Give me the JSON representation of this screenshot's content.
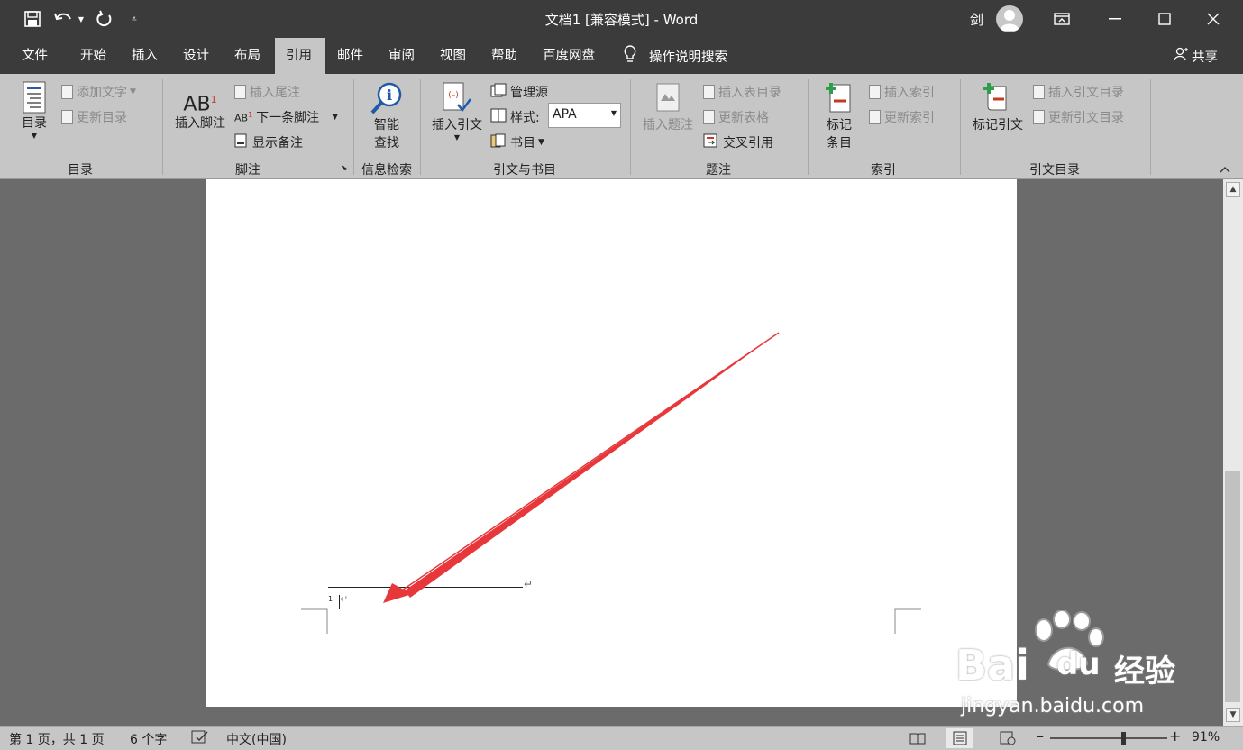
{
  "window": {
    "title": "文档1 [兼容模式]  -  Word",
    "user": "剑"
  },
  "quick_access": {
    "save_icon": "save-icon",
    "undo_icon": "undo-icon",
    "redo_icon": "redo-icon",
    "customize_icon": "customize-icon"
  },
  "tabs": [
    {
      "label": "文件"
    },
    {
      "label": "开始"
    },
    {
      "label": "插入"
    },
    {
      "label": "设计"
    },
    {
      "label": "布局"
    },
    {
      "label": "引用",
      "active": true
    },
    {
      "label": "邮件"
    },
    {
      "label": "审阅"
    },
    {
      "label": "视图"
    },
    {
      "label": "帮助"
    },
    {
      "label": "百度网盘"
    }
  ],
  "tell_me": "操作说明搜索",
  "share": "共享",
  "ribbon": {
    "toc": {
      "label": "目录",
      "toc_button": "目录",
      "add_text": "添加文字",
      "update_toc": "更新目录"
    },
    "footnotes": {
      "label": "脚注",
      "insert_footnote": "插入脚注",
      "insert_endnote": "插入尾注",
      "next_footnote": "下一条脚注",
      "show_notes": "显示备注"
    },
    "research": {
      "label": "信息检索",
      "smart_lookup_line1": "智能",
      "smart_lookup_line2": "查找"
    },
    "citations": {
      "label": "引文与书目",
      "insert_citation": "插入引文",
      "manage_sources": "管理源",
      "style_label": "样式:",
      "style_value": "APA",
      "bibliography": "书目"
    },
    "captions": {
      "label": "题注",
      "insert_caption": "插入题注",
      "insert_table_of_figures": "插入表目录",
      "update_table": "更新表格",
      "cross_reference": "交叉引用"
    },
    "index": {
      "label": "索引",
      "mark_entry_line1": "标记",
      "mark_entry_line2": "条目",
      "insert_index": "插入索引",
      "update_index": "更新索引"
    },
    "toa": {
      "label": "引文目录",
      "mark_citation": "标记引文",
      "insert_toa": "插入引文目录",
      "update_toa": "更新引文目录"
    }
  },
  "document": {
    "footnote_number": "1",
    "para_mark": "↵"
  },
  "status": {
    "page": "第 1 页，共 1 页",
    "words": "6 个字",
    "language": "中文(中国)",
    "zoom": "91%",
    "zoom_level": 0.62
  },
  "watermark": {
    "brand": "Bai",
    "brand2": "du",
    "brand_cn": "经验",
    "url": "jingyan.baidu.com"
  },
  "colors": {
    "titlebar": "#3b3b3b",
    "ribbon": "#c6c6c6",
    "arrow": "#e8373a"
  }
}
